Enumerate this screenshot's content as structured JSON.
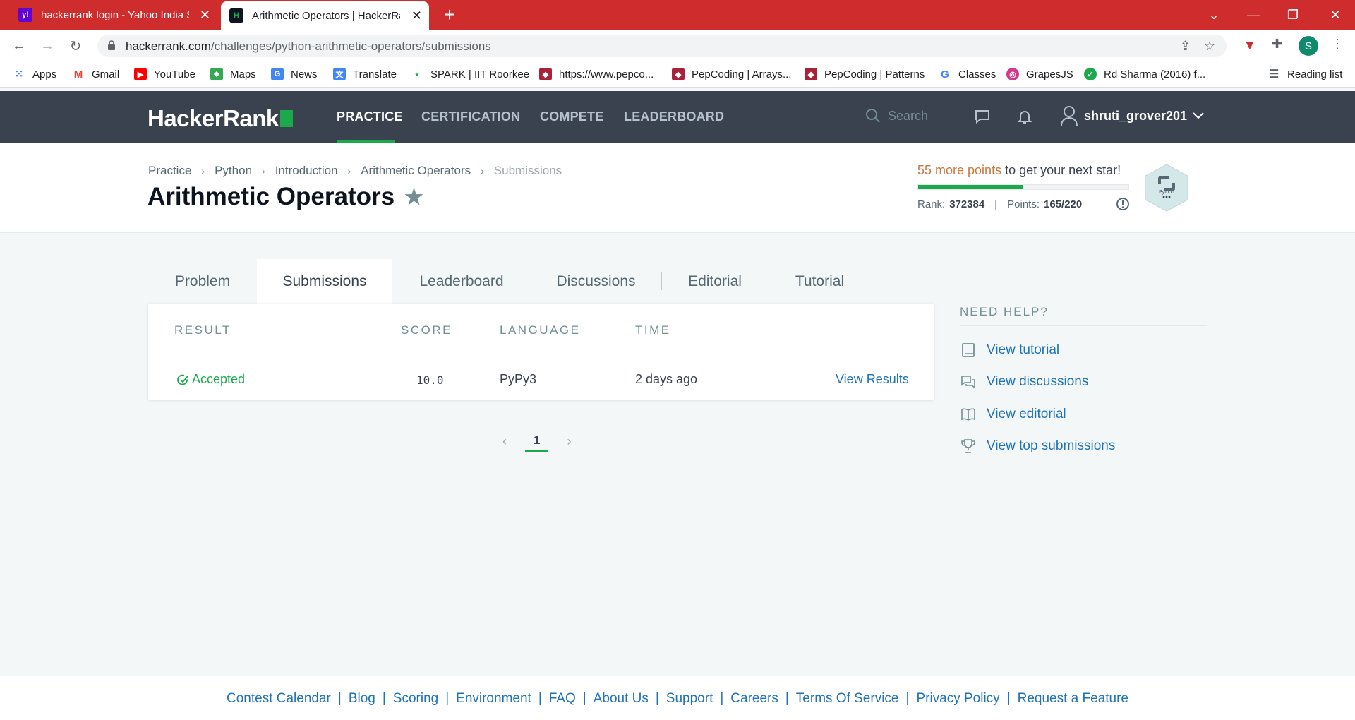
{
  "browser": {
    "tabs": [
      {
        "title": "hackerrank login - Yahoo India Se",
        "favicon": "yahoo-icon"
      },
      {
        "title": "Arithmetic Operators | HackerRa",
        "favicon": "hackerrank-icon"
      }
    ],
    "url_host": "hackerrank.com",
    "url_path": "/challenges/python-arithmetic-operators/submissions",
    "profile_initial": "S",
    "bookmarks": [
      {
        "label": "Apps",
        "icon": "apps-grid-icon"
      },
      {
        "label": "Gmail",
        "icon": "gmail-icon"
      },
      {
        "label": "YouTube",
        "icon": "youtube-icon"
      },
      {
        "label": "Maps",
        "icon": "maps-icon"
      },
      {
        "label": "News",
        "icon": "news-icon"
      },
      {
        "label": "Translate",
        "icon": "translate-icon"
      },
      {
        "label": "SPARK  | IIT Roorkee",
        "icon": "spark-icon"
      },
      {
        "label": "https://www.pepco...",
        "icon": "pepcoding-icon"
      },
      {
        "label": "PepCoding | Arrays...",
        "icon": "pepcoding-icon"
      },
      {
        "label": "PepCoding | Patterns",
        "icon": "pepcoding-icon"
      },
      {
        "label": "Classes",
        "icon": "google-icon"
      },
      {
        "label": "GrapesJS",
        "icon": "grapesjs-icon"
      },
      {
        "label": "Rd Sharma (2016) f...",
        "icon": "rd-sharma-icon"
      }
    ],
    "reading_list": "Reading list"
  },
  "header": {
    "logo": "HackerRank",
    "nav": [
      "PRACTICE",
      "CERTIFICATION",
      "COMPETE",
      "LEADERBOARD"
    ],
    "search_placeholder": "Search",
    "username": "shruti_grover201"
  },
  "challenge": {
    "breadcrumb": [
      "Practice",
      "Python",
      "Introduction",
      "Arithmetic Operators",
      "Submissions"
    ],
    "title": "Arithmetic Operators",
    "points_highlight": "55 more points",
    "points_rest": " to get your next star!",
    "progress_fraction": 0.5,
    "rank_label": "Rank:",
    "rank_value": "372384",
    "points_label": "Points:",
    "points_value": "165/220",
    "badge_label": "Python"
  },
  "tabs": [
    "Problem",
    "Submissions",
    "Leaderboard",
    "Discussions",
    "Editorial",
    "Tutorial"
  ],
  "submissions": {
    "columns": [
      "RESULT",
      "SCORE",
      "LANGUAGE",
      "TIME"
    ],
    "rows": [
      {
        "result": "Accepted",
        "score": "10.0",
        "language": "PyPy3",
        "time": "2 days ago",
        "action": "View Results"
      }
    ],
    "page": "1"
  },
  "help": {
    "title": "NEED HELP?",
    "items": [
      "View tutorial",
      "View discussions",
      "View editorial",
      "View top submissions"
    ]
  },
  "footer": {
    "links": [
      "Contest Calendar",
      "Blog",
      "Scoring",
      "Environment",
      "FAQ",
      "About Us",
      "Support",
      "Careers",
      "Terms Of Service",
      "Privacy Policy",
      "Request a Feature"
    ]
  },
  "colors": {
    "brand_green": "#1ba94c",
    "nav_bg": "#39424e",
    "link_blue": "#1f73b7",
    "tabbar_red": "#cf2d2d",
    "points_orange": "#c9783f"
  }
}
